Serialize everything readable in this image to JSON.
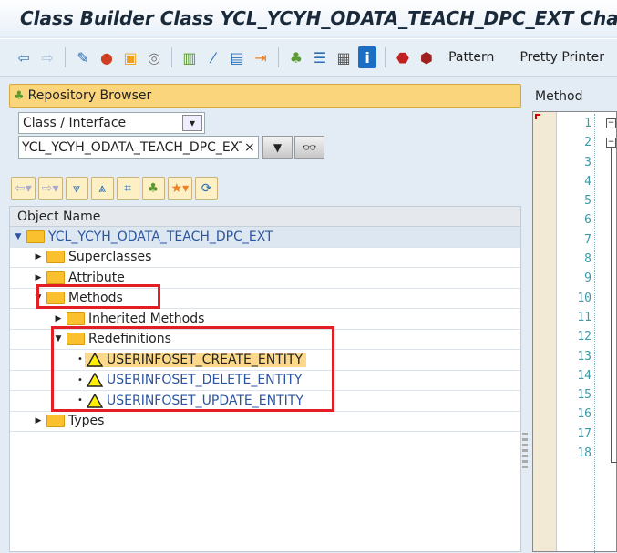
{
  "title": "Class Builder Class YCL_YCYH_ODATA_TEACH_DPC_EXT Change",
  "toolbar": {
    "icons": [
      "back-icon",
      "forward-icon",
      "display-change-icon",
      "active-inactive-icon",
      "other-object-icon",
      "where-used-icon",
      "object-list-icon",
      "wizard-icon",
      "local-types-icon",
      "redefine-icon",
      "hierarchy-icon",
      "outline-icon",
      "layout-icon",
      "info-icon",
      "breakpoint-session-icon",
      "breakpoint-user-icon"
    ],
    "pattern": "Pattern",
    "pretty": "Pretty Printer"
  },
  "repo": {
    "title": "Repository Browser",
    "object_type": "Class / Interface",
    "object_name": "YCL_YCYH_ODATA_TEACH_DPC_EXT",
    "clear": "×"
  },
  "tree": {
    "header": "Object Name",
    "root": "YCL_YCYH_ODATA_TEACH_DPC_EXT",
    "nodes": [
      "Superclasses",
      "Attribute",
      "Methods",
      "Inherited Methods",
      "Redefinitions"
    ],
    "methods": [
      "USERINFOSET_CREATE_ENTITY",
      "USERINFOSET_DELETE_ENTITY",
      "USERINFOSET_UPDATE_ENTITY"
    ],
    "types": "Types"
  },
  "editor": {
    "header": "Method",
    "line_numbers": "1\n2\n3\n4\n5\n6\n7\n8\n9\n10\n11\n12\n13\n14\n15\n16\n17\n18"
  },
  "colors": {
    "highlight": "#fcd98a",
    "annotation": "#e31e24",
    "link": "#2a55a0"
  }
}
